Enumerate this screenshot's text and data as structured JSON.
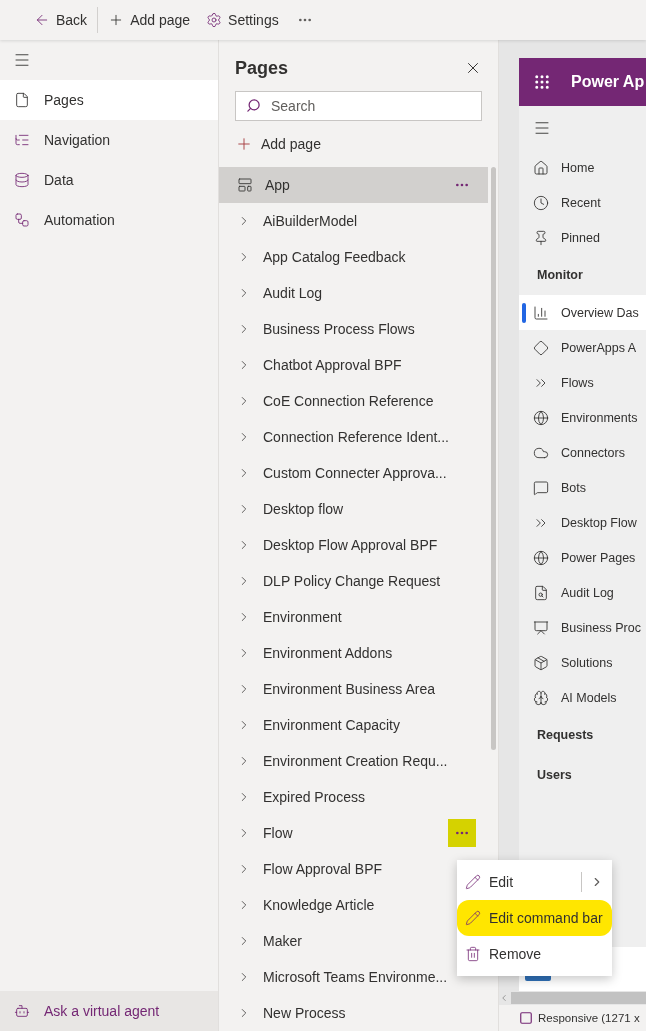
{
  "toolbar": {
    "items": [
      {
        "kind": "back",
        "label": "Back"
      },
      {
        "kind": "add",
        "label": "Add page"
      },
      {
        "kind": "settings",
        "label": "Settings"
      }
    ]
  },
  "sidebar": {
    "items": [
      {
        "kind": "page",
        "label": "Pages",
        "selected": true
      },
      {
        "kind": "nav",
        "label": "Navigation",
        "selected": false
      },
      {
        "kind": "data",
        "label": "Data",
        "selected": false
      },
      {
        "kind": "flow",
        "label": "Automation",
        "selected": false
      }
    ],
    "footer": "Ask a virtual agent"
  },
  "pages_panel": {
    "title": "Pages",
    "search": {
      "placeholder": "Search"
    },
    "add_label": "Add page",
    "items": [
      {
        "label": "App",
        "kind": "app",
        "selected": true
      },
      {
        "label": "AiBuilderModel",
        "selected": false
      },
      {
        "label": "App Catalog Feedback",
        "selected": false
      },
      {
        "label": "Audit Log",
        "selected": false
      },
      {
        "label": "Business Process Flows",
        "selected": false
      },
      {
        "label": "Chatbot Approval BPF",
        "selected": false
      },
      {
        "label": "CoE Connection Reference",
        "selected": false
      },
      {
        "label": "Connection Reference Ident...",
        "selected": false
      },
      {
        "label": "Custom Connecter Approva...",
        "selected": false
      },
      {
        "label": "Desktop flow",
        "selected": false
      },
      {
        "label": "Desktop Flow Approval BPF",
        "selected": false
      },
      {
        "label": "DLP Policy Change Request",
        "selected": false
      },
      {
        "label": "Environment",
        "selected": false
      },
      {
        "label": "Environment Addons",
        "selected": false
      },
      {
        "label": "Environment Business Area",
        "selected": false
      },
      {
        "label": "Environment Capacity",
        "selected": false
      },
      {
        "label": "Environment Creation Requ...",
        "selected": false
      },
      {
        "label": "Expired Process",
        "selected": false
      },
      {
        "label": "Flow",
        "selected": false,
        "menu_open": true
      },
      {
        "label": "Flow Approval BPF",
        "selected": false
      },
      {
        "label": "Knowledge Article",
        "selected": false
      },
      {
        "label": "Maker",
        "selected": false
      },
      {
        "label": "Microsoft Teams Environme...",
        "selected": false
      },
      {
        "label": "New Process",
        "selected": false
      }
    ],
    "context_menu": [
      {
        "kind": "edit",
        "label": "Edit",
        "submenu": true,
        "highlighted": false
      },
      {
        "kind": "edit",
        "label": "Edit command bar",
        "submenu": false,
        "highlighted": true
      },
      {
        "kind": "remove",
        "label": "Remove",
        "submenu": false,
        "highlighted": false
      }
    ]
  },
  "preview": {
    "app_title": "Power Ap",
    "nav": [
      {
        "kind": "home",
        "label": "Home",
        "selected": false
      },
      {
        "kind": "recent",
        "label": "Recent",
        "selected": false
      },
      {
        "kind": "pin",
        "label": "Pinned",
        "selected": false
      },
      {
        "kind": "group",
        "label": "Monitor"
      },
      {
        "kind": "dash",
        "label": "Overview Das",
        "selected": true
      },
      {
        "kind": "apps",
        "label": "PowerApps A",
        "selected": false
      },
      {
        "kind": "flow",
        "label": "Flows",
        "selected": false
      },
      {
        "kind": "env",
        "label": "Environments",
        "selected": false
      },
      {
        "kind": "conn",
        "label": "Connectors",
        "selected": false
      },
      {
        "kind": "bot",
        "label": "Bots",
        "selected": false
      },
      {
        "kind": "flow",
        "label": "Desktop Flow",
        "selected": false
      },
      {
        "kind": "globe",
        "label": "Power Pages",
        "selected": false
      },
      {
        "kind": "audit",
        "label": "Audit Log",
        "selected": false
      },
      {
        "kind": "bpf",
        "label": "Business Proc",
        "selected": false
      },
      {
        "kind": "sol",
        "label": "Solutions",
        "selected": false
      },
      {
        "kind": "ai",
        "label": "AI Models",
        "selected": false
      },
      {
        "kind": "group",
        "label": "Requests"
      },
      {
        "kind": "group",
        "label": "Users"
      }
    ],
    "status": "Responsive (1271 x"
  }
}
